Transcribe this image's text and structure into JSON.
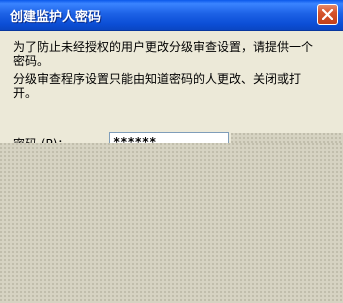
{
  "dialog": {
    "title": "创建监护人密码",
    "description_1": "为了防止未经授权的用户更改分级审查设置，请提供一个密码。",
    "description_2": "分级审查程序设置只能由知道密码的人更改、关闭或打开。",
    "password_label": "密码 (P)：",
    "password_masked": "******"
  },
  "icons": {
    "close": "close-x-icon"
  }
}
